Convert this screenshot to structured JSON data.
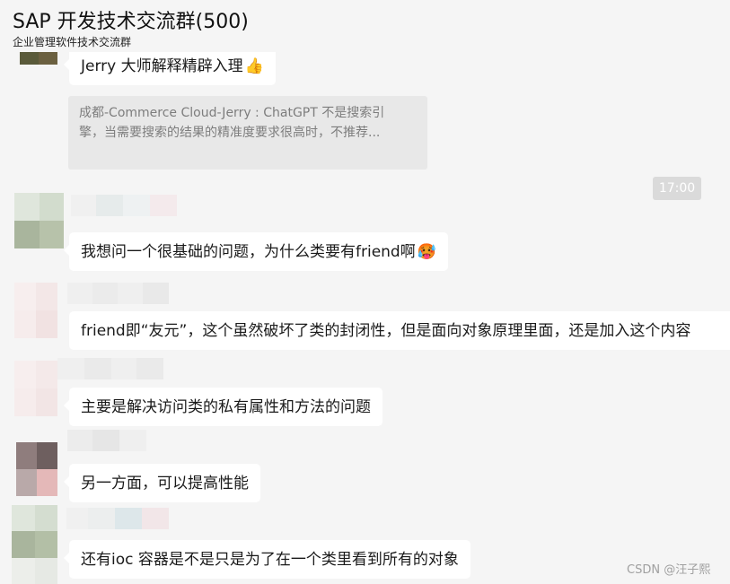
{
  "header": {
    "title": "SAP 开发技术交流群(500)",
    "subtitle": "企业管理软件技术交流群"
  },
  "messages": [
    {
      "text": "Jerry 大师解释精辟入理",
      "emoji": "👍"
    },
    {
      "text": "我想问一个很基础的问题，为什么类要有friend啊",
      "emoji": "🥵"
    },
    {
      "text": "friend即“友元”，这个虽然破坏了类的封闭性，但是面向对象原理里面，还是加入这个内容"
    },
    {
      "text": "主要是解决访问类的私有属性和方法的问题"
    },
    {
      "text": "另一方面，可以提高性能"
    },
    {
      "text": "还有ioc 容器是不是只是为了在一个类里看到所有的对象"
    }
  ],
  "quote": {
    "line1": "成都-Commerce Cloud-Jerry : ChatGPT 不是搜索引",
    "line2": "擎，当需要搜索的结果的精准度要求很高时，不推荐..."
  },
  "timestamp": "17:00",
  "watermark": "CSDN @汪子熙",
  "colors": {
    "background": "#f5f5f5",
    "bubble": "#ffffff",
    "quote_bg": "#e8e8e8",
    "time_bg": "#dadada"
  }
}
